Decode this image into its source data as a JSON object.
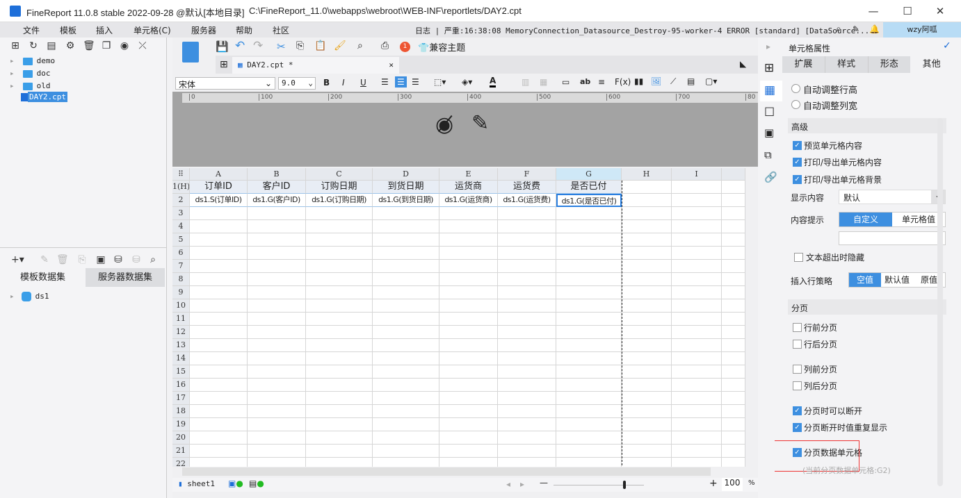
{
  "title": {
    "app": "FineReport 11.0.8 stable 2022-09-28 @默认[本地目录]",
    "path": "C:\\FineReport_11.0\\webapps\\webroot\\WEB-INF\\reportlets/DAY2.cpt"
  },
  "menu": [
    "文件",
    "模板",
    "插入",
    "单元格(C)",
    "服务器",
    "帮助",
    "社区"
  ],
  "log": "日志 | 严重:16:38:08 MemoryConnection_Datasource_Destroy-95-worker-4 ERROR [standard] [DataSource...",
  "user": "wzy阿呱",
  "tree": [
    "demo",
    "doc",
    "old",
    "DAY2.cpt"
  ],
  "ds_tabs": [
    "模板数据集",
    "服务器数据集"
  ],
  "datasets": [
    "ds1"
  ],
  "toolbar": {
    "badge": "1",
    "theme": "兼容主题",
    "font": "宋体",
    "size": "9.0"
  },
  "tab": "DAY2.cpt *",
  "ruler": [
    "0",
    "100",
    "200",
    "300",
    "400",
    "500",
    "600",
    "700",
    "80"
  ],
  "columns": [
    "A",
    "B",
    "C",
    "D",
    "E",
    "F",
    "G",
    "H",
    "I"
  ],
  "row_labels": [
    "1(H)",
    "2",
    "3",
    "4",
    "5",
    "6",
    "7",
    "8",
    "9",
    "10",
    "11",
    "12",
    "13",
    "14",
    "15",
    "16",
    "17",
    "18",
    "19",
    "20",
    "21",
    "22"
  ],
  "row1": [
    "订单ID",
    "客户ID",
    "订购日期",
    "到货日期",
    "运货商",
    "运货费",
    "是否已付"
  ],
  "row2": [
    "ds1.S(订单ID)",
    "ds1.G(客户ID)",
    "ds1.G(订购日期)",
    "ds1.G(到货日期)",
    "ds1.G(运货商)",
    "ds1.G(运货费)",
    "ds1.G(是否已付)"
  ],
  "sheet": "sheet1",
  "zoom": "100",
  "zoom_pct": "%",
  "panel": {
    "title": "单元格属性",
    "tabs": [
      "扩展",
      "样式",
      "形态",
      "其他"
    ],
    "radios": [
      "自动调整行高",
      "自动调整列宽"
    ],
    "adv": "高级",
    "adv_checks": [
      {
        "label": "预览单元格内容",
        "on": true
      },
      {
        "label": "打印/导出单元格内容",
        "on": true
      },
      {
        "label": "打印/导出单元格背景",
        "on": true
      }
    ],
    "display_label": "显示内容",
    "display_value": "默认",
    "tip_label": "内容提示",
    "tip_opts": [
      "自定义",
      "单元格值"
    ],
    "hide_label": "文本超出时隐藏",
    "insert_label": "插入行策略",
    "insert_opts": [
      "空值",
      "默认值",
      "原值"
    ],
    "page": "分页",
    "page_checks": [
      {
        "label": "行前分页",
        "on": false
      },
      {
        "label": "行后分页",
        "on": false
      },
      {
        "label": "列前分页",
        "on": false
      },
      {
        "label": "列后分页",
        "on": false
      },
      {
        "label": "分页时可以断开",
        "on": true
      },
      {
        "label": "分页断开时值重复显示",
        "on": true
      },
      {
        "label": "分页数据单元格",
        "on": true
      }
    ],
    "current": "(当前分页数据单元格:G2)"
  }
}
